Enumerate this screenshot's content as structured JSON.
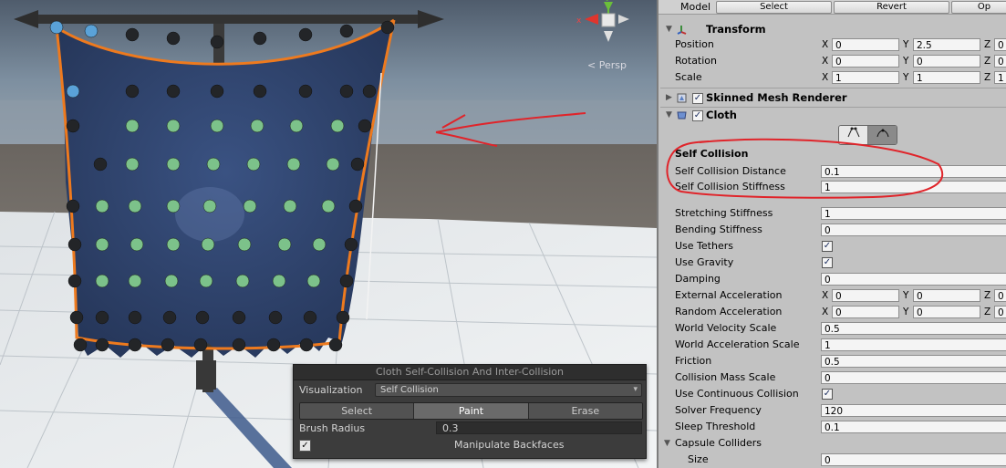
{
  "scene": {
    "persp_label": "< Persp",
    "overlay": {
      "title": "Cloth Self-Collision And Inter-Collision",
      "visualization_label": "Visualization",
      "visualization_value": "Self Collision",
      "modes": [
        "Select",
        "Paint",
        "Erase"
      ],
      "active_mode": "Paint",
      "brush_radius_label": "Brush Radius",
      "brush_radius_value": "0.3",
      "manipulate_backfaces_label": "Manipulate Backfaces",
      "manipulate_backfaces_checked": true
    },
    "colors": {
      "sky_top": "#5a6878",
      "ground": "#6b6863",
      "cloth": "#2c3f66",
      "outline": "#ee7a1e",
      "particle_dark": "#232528",
      "particle_green": "#7cc28a",
      "particle_blue": "#5aa2d8",
      "annotation": "#e0242a"
    }
  },
  "toolbar": {
    "model_label": "Model",
    "select_label": "Select",
    "revert_label": "Revert",
    "open_label": "Op"
  },
  "transform": {
    "title": "Transform",
    "position_label": "Position",
    "position": {
      "x": "0",
      "y": "2.5",
      "z": "0"
    },
    "rotation_label": "Rotation",
    "rotation": {
      "x": "0",
      "y": "0",
      "z": "0"
    },
    "scale_label": "Scale",
    "scale": {
      "x": "1",
      "y": "1",
      "z": "1"
    }
  },
  "skinned_mesh_renderer": {
    "title": "Skinned Mesh Renderer"
  },
  "cloth": {
    "title": "Cloth",
    "self_collision_heading": "Self Collision",
    "self_collision_distance_label": "Self Collision Distance",
    "self_collision_distance": "0.1",
    "self_collision_stiffness_label": "Self Collision Stiffness",
    "self_collision_stiffness": "1",
    "stretching_stiffness_label": "Stretching Stiffness",
    "stretching_stiffness": "1",
    "bending_stiffness_label": "Bending Stiffness",
    "bending_stiffness": "0",
    "use_tethers_label": "Use Tethers",
    "use_tethers": true,
    "use_gravity_label": "Use Gravity",
    "use_gravity": true,
    "damping_label": "Damping",
    "damping": "0",
    "external_acceleration_label": "External Acceleration",
    "external_acceleration": {
      "x": "0",
      "y": "0",
      "z": "0"
    },
    "random_acceleration_label": "Random Acceleration",
    "random_acceleration": {
      "x": "0",
      "y": "0",
      "z": "0"
    },
    "world_velocity_scale_label": "World Velocity Scale",
    "world_velocity_scale": "0.5",
    "world_acceleration_scale_label": "World Acceleration Scale",
    "world_acceleration_scale": "1",
    "friction_label": "Friction",
    "friction": "0.5",
    "collision_mass_scale_label": "Collision Mass Scale",
    "collision_mass_scale": "0",
    "use_continuous_collision_label": "Use Continuous Collision",
    "use_continuous_collision": true,
    "solver_frequency_label": "Solver Frequency",
    "solver_frequency": "120",
    "sleep_threshold_label": "Sleep Threshold",
    "sleep_threshold": "0.1",
    "capsule_colliders_label": "Capsule Colliders",
    "size_label": "Size",
    "size": "0"
  },
  "axis_labels": {
    "x": "X",
    "y": "Y",
    "z": "Z"
  },
  "checkmark": "✓",
  "icons": {
    "fold_open": "▼",
    "fold_closed": "▶",
    "dropdown": "▾"
  }
}
